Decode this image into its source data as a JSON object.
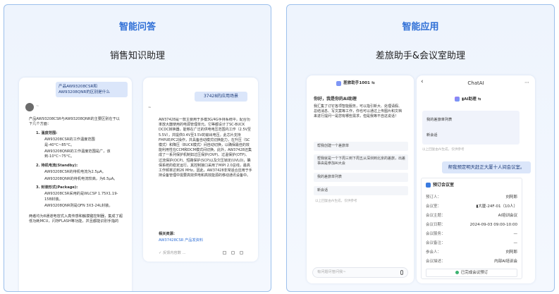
{
  "left_panel": {
    "title": "智能问答",
    "subtitle": "销售知识助理",
    "phone1": {
      "question": "产品AW93208CSR和AW93208QNR的区别是什么",
      "answer_intro": "产品AW93208CSR与AW93208QNR的主要区别在于以下几个方面：",
      "sections": [
        {
          "head": "1. 温度范围:",
          "bullets": [
            "AW93208CSR的工作温度范围是-40°C~85°C。",
            "AW93208QNR的工作温度范围是广，该到-10°C~75°C。"
          ]
        },
        {
          "head": "2. 待机电流(Standby):",
          "bullets": [
            "AW93208CSR的待机电流为2.5μA。",
            "AW93208QNR的待机电流较高，为6.5μA。"
          ]
        },
        {
          "head": "3. 封装形式(Package):",
          "bullets": [
            "AW93208CSR采用的是WLCSP 1.75X1.19-15B封装。",
            "AW93208QNR则是QFN 3X3-24L封装。"
          ]
        }
      ],
      "footer": "两者均为8通道电容式入亮传感和触摸键控制器，集成了超低功耗MCU，闪存FLASH等功能，并且都能识别手指的",
      "name_blur": "~"
    },
    "phone2": {
      "question": "37428的应用场景",
      "name_blur": "~",
      "answer": "AW37428是一款主要用于多模3G/4G手持系统中，配合功率放大器使用的电源管理单元。它等都设计了SC-BUCK DCDC转换器，能够在广泛的供电电压范围内工作（2.5V至5.5V），并提供0.4V至3.5V的输出电压。此芯片支持FHPUE/PC2操作，并具备自动模式切换能力，在升压（SC模式）和降压（BUCK模式）间自动切换，以确保最佳的效能利用性在CCM和DCM模式间切换。此外，AW37428还集成了一系列保护机制如过压保护(OVP)、过温保护(OTP)、过流保护(OCP)、短路保护(SCP)以及欠压锁定(UVLO)，确保系统的稳定运行。其控制接口采用了MIPI 2.0总线，最高工作频率达到26 MHz。因此，AW37428非常适合应用于手持设备管理中需要高效供电和高效能源的移动通讯设备中。",
      "related_title": "相关资源：",
      "related_link": "AW37428CSR 产品发资料",
      "feedback": "✓ 反馈内容数 ..."
    }
  },
  "right_panel": {
    "title": "智能应用",
    "subtitle": "差旅助手&会议室助理",
    "phone1": {
      "header": "差旅助手1001 ⇆",
      "greeting": "你好，我是你的AI助理",
      "intro": "我汇集了订钉各项智能服务，可以指引新大、处理请假、总结消息、写文案等工作，你也可以通过上传图片和文档来进行提问一是您有哪些需求，但是我等不自这说话！",
      "suggestions": [
        "帮我创建一个差旅单",
        "帮我就是一个下周三到下周五从深圳到北京的差旅，出差事由是参加AI大会",
        "我的差旅单列表",
        "新会话"
      ],
      "footer_note": "以上回复由AI生成，仅供参考",
      "input_placeholder": "有问题尽管问我~"
    },
    "phone2": {
      "back": "‹",
      "title": "ChatAI",
      "more": "⋯",
      "bot_name": "▮AI助理 ⇆",
      "items": [
        "我的差旅单列表",
        "新会话"
      ],
      "note": "以上回复由AI生成，仅供参考",
      "user_msg": "帮我预定明天赶正大厦十人间会议室。",
      "card_title": "预订会议室",
      "rows": [
        {
          "label": "预订人：",
          "value": "刘阿郎"
        },
        {
          "label": "会议室：",
          "value": "▮大厦-24F-01（10人）"
        },
        {
          "label": "会议主题：",
          "value": "AI培训会议"
        },
        {
          "label": "会议日期：",
          "value": "2024-09-03 09:00-10:00"
        },
        {
          "label": "会议服务：",
          "value": "—"
        },
        {
          "label": "会议备注：",
          "value": "—"
        },
        {
          "label": "参会人：",
          "value": "刘阿郎"
        },
        {
          "label": "会议描述：",
          "value": "内部AI培训会"
        }
      ],
      "confirm": "已完成会议预订"
    }
  },
  "colors": {
    "accent": "#2f6fd6",
    "border": "#9cc0ec",
    "bubble": "#dbe6fa"
  }
}
